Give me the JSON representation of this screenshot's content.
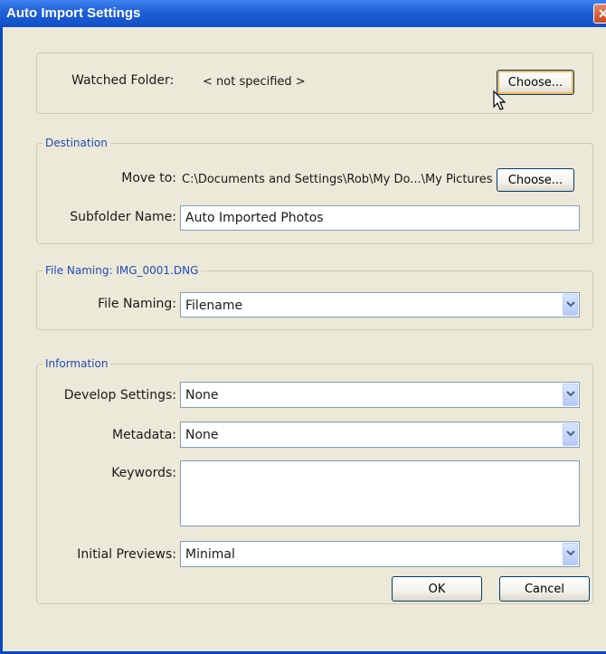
{
  "window": {
    "title": "Auto Import Settings",
    "close_glyph": "✕"
  },
  "watched": {
    "label": "Watched Folder:",
    "value": "< not specified >",
    "choose_label": "Choose..."
  },
  "destination": {
    "legend": "Destination",
    "move_to_label": "Move to:",
    "move_to_value": "C:\\Documents and Settings\\Rob\\My Do...\\My Pictures",
    "choose_label": "Choose...",
    "subfolder_label": "Subfolder Name:",
    "subfolder_value": "Auto Imported Photos"
  },
  "file_naming": {
    "legend": "File Naming:  IMG_0001.DNG",
    "label": "File Naming:",
    "value": "Filename"
  },
  "information": {
    "legend": "Information",
    "develop_label": "Develop Settings:",
    "develop_value": "None",
    "metadata_label": "Metadata:",
    "metadata_value": "None",
    "keywords_label": "Keywords:",
    "keywords_value": "",
    "previews_label": "Initial Previews:",
    "previews_value": "Minimal"
  },
  "footer": {
    "ok_label": "OK",
    "cancel_label": "Cancel"
  },
  "icons": {
    "dropdown": "chevron-down-icon",
    "close": "close-icon",
    "cursor": "mouse-pointer-icon"
  }
}
